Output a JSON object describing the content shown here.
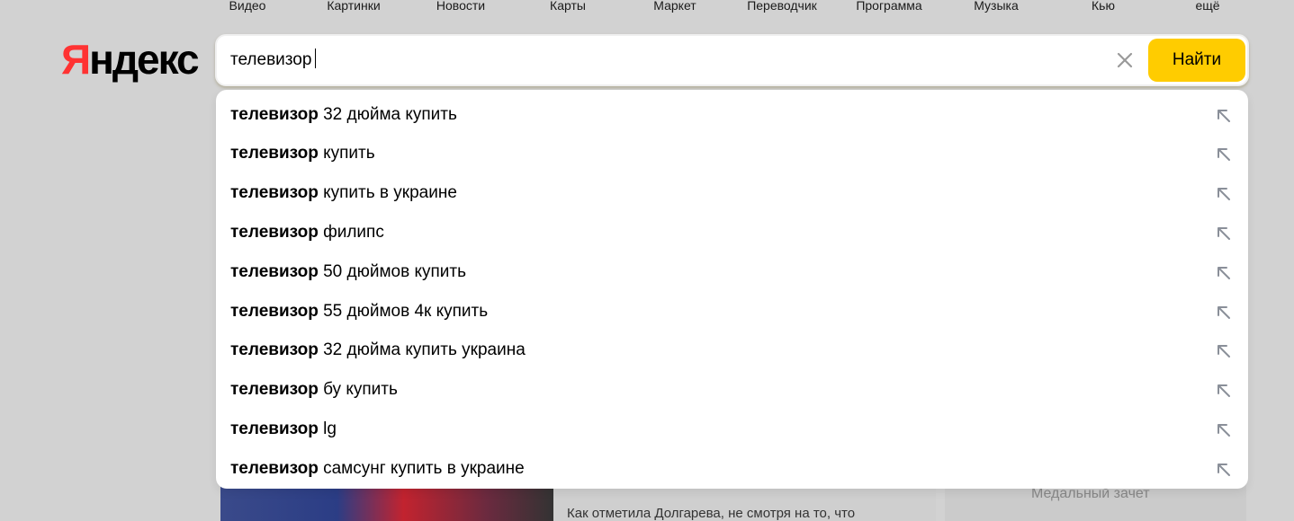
{
  "nav": {
    "items": [
      {
        "label": "Видео"
      },
      {
        "label": "Картинки"
      },
      {
        "label": "Новости"
      },
      {
        "label": "Карты"
      },
      {
        "label": "Маркет"
      },
      {
        "label": "Переводчик"
      },
      {
        "label": "Программа"
      },
      {
        "label": "Музыка"
      },
      {
        "label": "Кью"
      },
      {
        "label": "ещё"
      }
    ]
  },
  "logo": {
    "first": "Я",
    "rest": "ндекс"
  },
  "search": {
    "value": "телевизор",
    "button_label": "Найти",
    "clear_icon": "close-icon"
  },
  "suggestions": [
    {
      "bold": "телевизор",
      "rest": " 32 дюйма купить"
    },
    {
      "bold": "телевизор",
      "rest": " купить"
    },
    {
      "bold": "телевизор",
      "rest": " купить в украине"
    },
    {
      "bold": "телевизор",
      "rest": " филипс"
    },
    {
      "bold": "телевизор",
      "rest": " 50 дюймов купить"
    },
    {
      "bold": "телевизор",
      "rest": " 55 дюймов 4к купить"
    },
    {
      "bold": "телевизор",
      "rest": " 32 дюйма купить украина"
    },
    {
      "bold": "телевизор",
      "rest": " бу купить"
    },
    {
      "bold": "телевизор",
      "rest": " lg"
    },
    {
      "bold": "телевизор",
      "rest": " самсунг купить в украине"
    }
  ],
  "background": {
    "news_text": "Как отметила Долгарева, не смотря на то, что",
    "quote_mark": "“",
    "medal_text": "Медальный зачет"
  },
  "colors": {
    "accent": "#ffcc00",
    "logo_red": "#f33"
  }
}
